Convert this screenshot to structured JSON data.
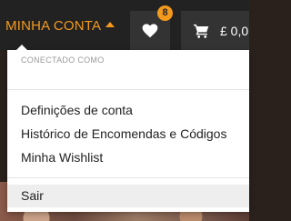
{
  "header": {
    "account_label": "MINHA CONTA",
    "wishlist_count": "8",
    "cart_total": "£ 0,0"
  },
  "account_menu": {
    "connected_label": "CONECTADO COMO",
    "items": [
      {
        "label": "Definições de conta"
      },
      {
        "label": "Histórico de Encomendas e Códigos"
      },
      {
        "label": "Minha Wishlist"
      }
    ],
    "logout_label": "Sair"
  },
  "colors": {
    "accent": "#f39a1d",
    "topbar": "#222222",
    "button_bg": "#333333"
  },
  "icons": [
    "caret-up-icon",
    "heart-icon",
    "cart-icon"
  ]
}
